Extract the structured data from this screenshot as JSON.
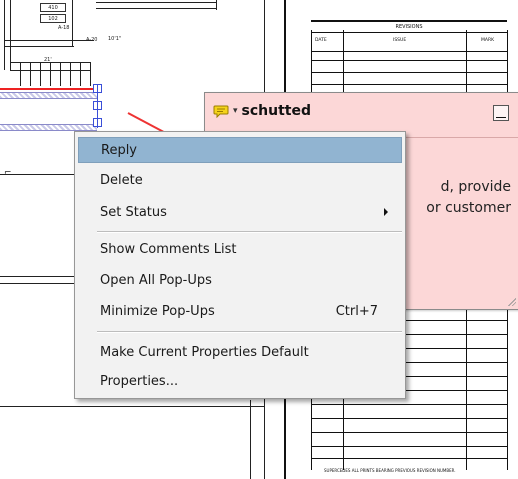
{
  "drawing": {
    "labels": {
      "box_a": "410",
      "box_b": "102",
      "label_a": "A-18",
      "label_b": "A-20",
      "label_c": "10'1\"",
      "label_d": "21'",
      "label_e": "8'10\""
    }
  },
  "revisions": {
    "title": "REVISIONS",
    "columns": [
      "DATE",
      "ISSUE",
      "MARK"
    ],
    "footer": "SUPERCEDES ALL PRINTS BEARING PREVIOUS REVISION NUMBER."
  },
  "popup": {
    "author": "schutted",
    "body_text": "d, provide\nor customer",
    "icon": "speech-bubble-icon",
    "colors": {
      "background": "#fcd7d7",
      "icon": "#f5d31b"
    }
  },
  "context_menu": {
    "items": [
      {
        "label": "Reply",
        "highlighted": true
      },
      {
        "label": "Delete"
      },
      {
        "label": "Set Status",
        "has_submenu": true
      },
      {
        "label": "Show Comments List"
      },
      {
        "label": "Open All Pop-Ups"
      },
      {
        "label": "Minimize Pop-Ups",
        "shortcut": "Ctrl+7"
      },
      {
        "label": "Make Current Properties Default"
      },
      {
        "label": "Properties..."
      }
    ],
    "colors": {
      "highlight": "#91b4d1",
      "background": "#f2f2f2"
    }
  }
}
